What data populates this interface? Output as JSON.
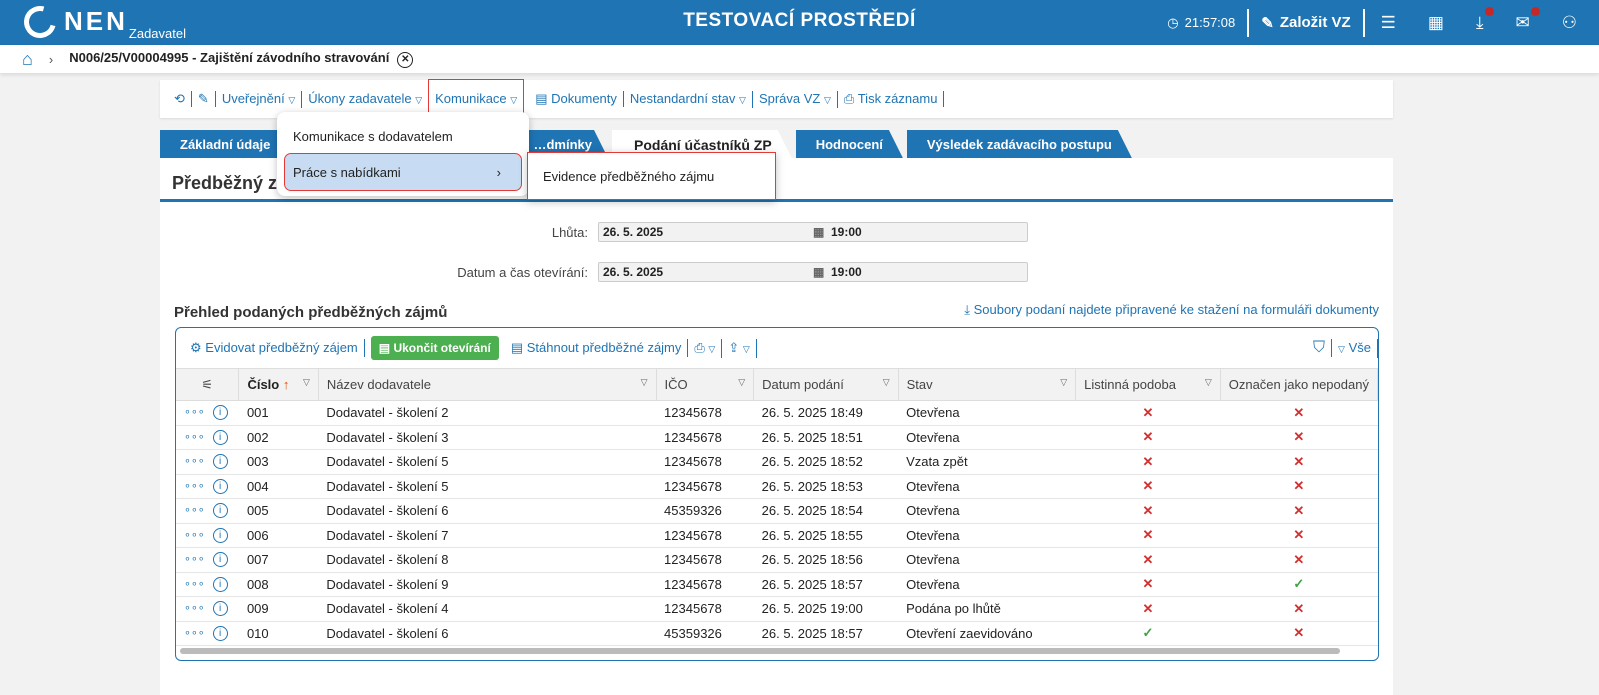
{
  "header": {
    "logo": "NEN",
    "logo_sub": "Zadavatel",
    "title": "TESTOVACÍ PROSTŘEDÍ",
    "clock": "21:57:08",
    "create": "Založit VZ",
    "accent": "#1f74b3"
  },
  "breadcrumb": {
    "item": "N006/25/V00004995 - Zajištění závodního stravování"
  },
  "toolbar": {
    "items": [
      "Uveřejnění",
      "Úkony zadavatele",
      "Komunikace",
      "Dokumenty",
      "Nestandardní stav",
      "Správa VZ",
      "Tisk záznamu"
    ]
  },
  "tabs": [
    "Základní údaje",
    "…dmínky",
    "Podání účastníků ZP",
    "Hodnocení",
    "Výsledek zadávacího postupu"
  ],
  "menu": {
    "items": [
      "Komunikace s dodavatelem",
      "Práce s nabídkami"
    ],
    "submenu": [
      "Evidence předběžného zájmu"
    ]
  },
  "panel": {
    "title": "Předběžný zájem",
    "fields": [
      {
        "label": "Lhůta:",
        "date": "26. 5. 2025",
        "time": "19:00"
      },
      {
        "label": "Datum a čas otevírání:",
        "date": "26. 5. 2025",
        "time": "19:00"
      }
    ],
    "section": "Přehled podaných předběžných zájmů",
    "download_note": "Soubory podaní najdete připravené ke stažení na formuláři dokumenty"
  },
  "grid": {
    "toolbar": {
      "evidovat": "Evidovat předběžný zájem",
      "ukoncit": "Ukončit otevírání",
      "stahnout": "Stáhnout předběžné zájmy",
      "filter_all": "Vše"
    },
    "columns": [
      "Číslo",
      "Název dodavatele",
      "IČO",
      "Datum podání",
      "Stav",
      "Listinná podoba",
      "Označen jako nepodaný"
    ],
    "rows": [
      [
        "001",
        "Dodavatel - školení 2",
        "12345678",
        "26. 5. 2025 18:49",
        "Otevřena",
        false,
        false
      ],
      [
        "002",
        "Dodavatel - školení 3",
        "12345678",
        "26. 5. 2025 18:51",
        "Otevřena",
        false,
        false
      ],
      [
        "003",
        "Dodavatel - školení 5",
        "12345678",
        "26. 5. 2025 18:52",
        "Vzata zpět",
        false,
        false
      ],
      [
        "004",
        "Dodavatel - školení 5",
        "12345678",
        "26. 5. 2025 18:53",
        "Otevřena",
        false,
        false
      ],
      [
        "005",
        "Dodavatel - školení 6",
        "45359326",
        "26. 5. 2025 18:54",
        "Otevřena",
        false,
        false
      ],
      [
        "006",
        "Dodavatel - školení 7",
        "12345678",
        "26. 5. 2025 18:55",
        "Otevřena",
        false,
        false
      ],
      [
        "007",
        "Dodavatel - školení 8",
        "12345678",
        "26. 5. 2025 18:56",
        "Otevřena",
        false,
        false
      ],
      [
        "008",
        "Dodavatel - školení 9",
        "12345678",
        "26. 5. 2025 18:57",
        "Otevřena",
        false,
        true
      ],
      [
        "009",
        "Dodavatel - školení 4",
        "12345678",
        "26. 5. 2025 19:00",
        "Podána po lhůtě",
        false,
        false
      ],
      [
        "010",
        "Dodavatel - školení 6",
        "45359326",
        "26. 5. 2025 18:57",
        "Otevření zaevidováno",
        true,
        false
      ]
    ]
  }
}
